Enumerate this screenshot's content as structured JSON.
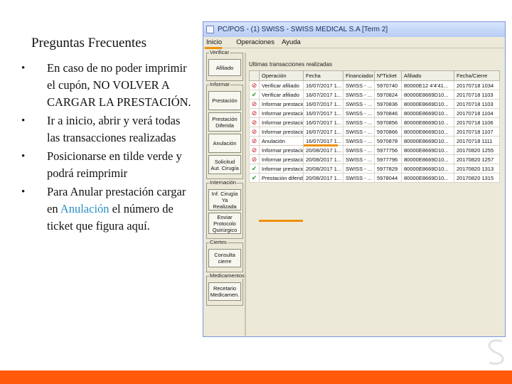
{
  "slide": {
    "title": "Preguntas Frecuentes",
    "bullets": [
      {
        "text": "En caso de no poder imprimir el cupón, NO VOLVER A CARGAR LA PRESTACIÓN."
      },
      {
        "text": "Ir a inicio, abrir y verá todas las transacciones realizadas"
      },
      {
        "text": "Posicionarse en tilde verde y podrá reimprimir"
      },
      {
        "before": "Para Anular  prestación cargar en ",
        "highlight": "Anulación",
        "after": " el número de ticket que figura aquí."
      }
    ],
    "colors": {
      "accent_bar": "#ff5a0a",
      "highlight": "#2a8fc6",
      "marker": "#f0900a"
    }
  },
  "window": {
    "title": "PC/POS - (1) SWISS - SWISS MEDICAL S.A [Term 2]",
    "menu": [
      "Inicio",
      "Operaciones",
      "Ayuda"
    ],
    "groups": [
      {
        "label": "Verificar",
        "buttons": [
          "Afiliado"
        ]
      },
      {
        "label": "Informar",
        "buttons": [
          "Prestación",
          "Prestación Diferida",
          "Anulación",
          "Solicitud Aut. Cirugía"
        ]
      },
      {
        "label": "Internación",
        "buttons": [
          "Inf. Cirugía Ya Realizada",
          "Enviar Protocolo Quirúrgico"
        ]
      },
      {
        "label": "Ciertes",
        "buttons": [
          "Consulta cierre"
        ]
      },
      {
        "label": "Medicamentos",
        "buttons": [
          "Recetario Medicamen."
        ]
      }
    ],
    "grid": {
      "title": "Ultimas transacciones realizadas",
      "columns": [
        "Operación",
        "Fecha",
        "Financiador",
        "NºTicket",
        "Afiliado",
        "Fecha/Cierre"
      ],
      "rows": [
        {
          "status": "error",
          "icon": "error-icon",
          "cells": [
            "Verificar afiliado",
            "16/07/2017 1...",
            "SWISS - ...",
            "5970740",
            "80000E12 4'4'41...",
            "20170718 1034"
          ]
        },
        {
          "status": "ok",
          "icon": "checkmark-icon",
          "cells": [
            "Verificar afiliado",
            "16/07/2017 1...",
            "SWISS - ...",
            "5970824",
            "80000E8669D10...",
            "20170718 1103"
          ]
        },
        {
          "status": "error",
          "icon": "error-icon",
          "cells": [
            "Informar prestación",
            "16/07/2017 1...",
            "SWISS - ...",
            "5970836",
            "80000E8669D10...",
            "20170718 1103"
          ]
        },
        {
          "status": "error",
          "icon": "error-icon",
          "cells": [
            "Informar prestación",
            "16/07/2017 1...",
            "SWISS - ...",
            "5970846",
            "80000E8669D10...",
            "20170718 1104"
          ]
        },
        {
          "status": "error",
          "icon": "error-icon",
          "cells": [
            "Informar prestación",
            "16/07/2017 1...",
            "SWISS - ...",
            "5970856",
            "80000E8669D10...",
            "20170718 1106"
          ]
        },
        {
          "status": "error",
          "icon": "error-icon",
          "cells": [
            "Informar prestación",
            "16/07/2017 1...",
            "SWISS - ...",
            "5970866",
            "80000E8669D10...",
            "20170718 1107"
          ]
        },
        {
          "status": "error",
          "icon": "error-icon",
          "cells": [
            "Anulación",
            "16/07/2017 1...",
            "SWISS - ...",
            "5970878",
            "80000E8669D10...",
            "20170718 1111"
          ]
        },
        {
          "status": "error",
          "icon": "error-icon",
          "cells": [
            "Informar prestación",
            "20/08/2017 1...",
            "SWISS - ...",
            "5977756",
            "80000E8669D10...",
            "20170820 1255"
          ]
        },
        {
          "status": "error",
          "icon": "error-icon",
          "cells": [
            "Informar prestación",
            "20/08/2017 1...",
            "SWISS - ...",
            "5977796",
            "80000E8669D10...",
            "20170820 1257"
          ]
        },
        {
          "status": "ok",
          "icon": "checkmark-icon",
          "cells": [
            "Informar prestación",
            "20/08/2017 1...",
            "SWISS - ...",
            "5977829",
            "80000E8669D10...",
            "20170820 1313"
          ]
        },
        {
          "status": "ok",
          "icon": "checkmark-icon",
          "cells": [
            "Prestación diferida",
            "20/08/2017 1...",
            "SWISS - ...",
            "5978044",
            "80000E8669D10...",
            "20170820 1315"
          ]
        }
      ]
    }
  }
}
